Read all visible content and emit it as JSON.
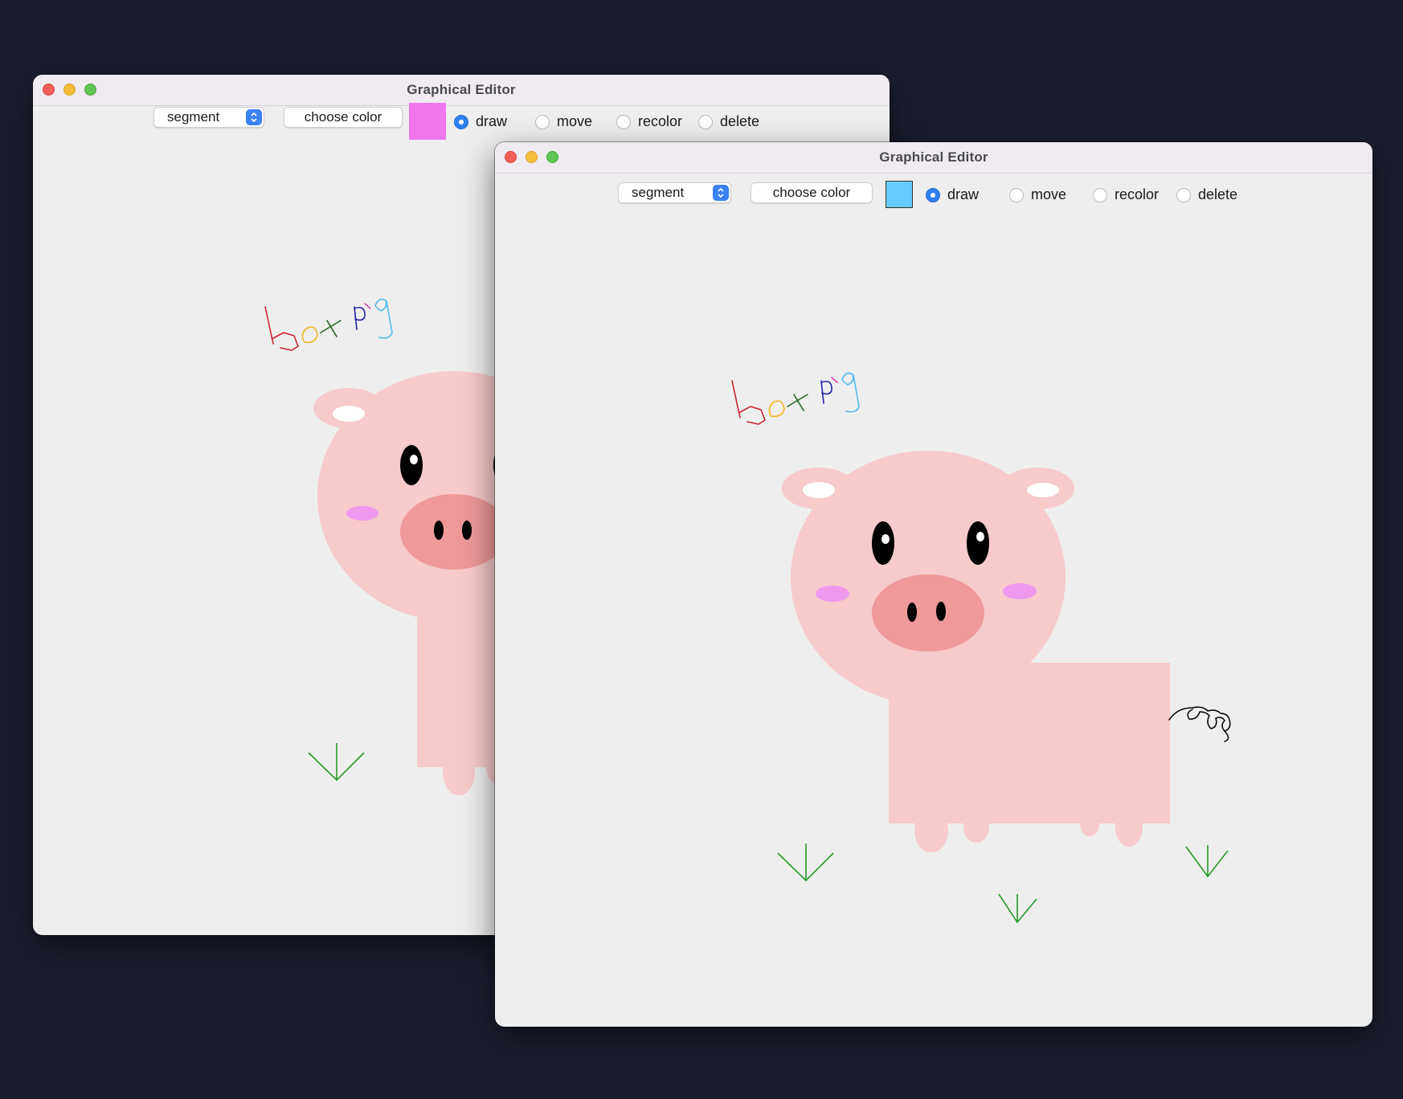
{
  "windows": [
    {
      "id": "back",
      "title": "Graphical Editor",
      "shape_select": "segment",
      "choose_color_label": "choose color",
      "current_color": "#ee77ee",
      "modes": [
        {
          "label": "draw",
          "selected": true
        },
        {
          "label": "move",
          "selected": false
        },
        {
          "label": "recolor",
          "selected": false
        },
        {
          "label": "delete",
          "selected": false
        }
      ]
    },
    {
      "id": "front",
      "title": "Graphical Editor",
      "shape_select": "segment",
      "choose_color_label": "choose color",
      "current_color": "#66ccff",
      "modes": [
        {
          "label": "draw",
          "selected": true
        },
        {
          "label": "move",
          "selected": false
        },
        {
          "label": "recolor",
          "selected": false
        },
        {
          "label": "delete",
          "selected": false
        }
      ]
    }
  ],
  "drawing_colors": {
    "pig_body": "#f7cacb",
    "snout": "#ef9999",
    "ear_inner": "#ffffff",
    "eye": "#000000",
    "cheek": "#ee99ee",
    "grass": "#2a9a2a",
    "tail": "#000000",
    "scribble_red": "#cc2233",
    "scribble_yellow": "#eebb22",
    "scribble_green": "#226622",
    "scribble_blue": "#2222aa",
    "scribble_pink": "#dd44aa",
    "scribble_cyan": "#55bbee"
  }
}
